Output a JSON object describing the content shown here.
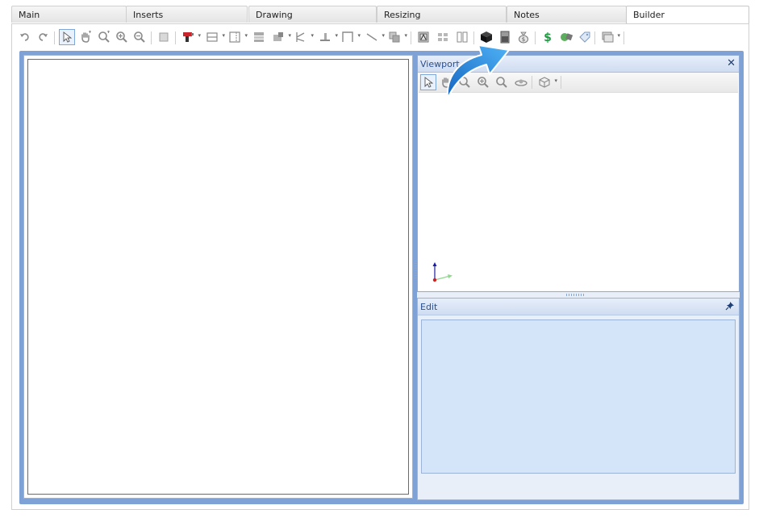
{
  "tabs": [
    {
      "label": "Main",
      "active": false
    },
    {
      "label": "Inserts",
      "active": false
    },
    {
      "label": "Drawing",
      "active": false
    },
    {
      "label": "Resizing",
      "active": false
    },
    {
      "label": "Notes",
      "active": false
    },
    {
      "label": "Builder",
      "active": true
    }
  ],
  "toolbar": {
    "icons": [
      "undo-icon",
      "redo-icon",
      "select-arrow-icon",
      "pan-hand-icon",
      "zoom-extents-icon",
      "zoom-in-icon",
      "zoom-out-icon",
      "page-icon",
      "drill-icon",
      "shelf-icon",
      "panel-icon",
      "drawer-icon",
      "hardware-icon",
      "route-icon",
      "level-icon",
      "frame-icon",
      "line-icon",
      "group-icon",
      "report-icon",
      "grid-icon",
      "split-icon",
      "cube-icon",
      "cabinet-icon",
      "money-bag-icon",
      "price-icon",
      "materials-icon",
      "tag-icon",
      "window-icon"
    ]
  },
  "viewport": {
    "title": "Viewport",
    "close_symbol": "✕",
    "tools": [
      "select-arrow-icon",
      "pan-hand-icon",
      "zoom-extents-icon",
      "zoom-in-icon",
      "zoom-out-icon",
      "orbit-icon",
      "view-cube-icon"
    ]
  },
  "edit": {
    "title": "Edit"
  },
  "colors": {
    "frame_blue": "#7ea2d6",
    "panel_header": "#cfdcf1",
    "edit_body": "#d5e5f9",
    "callout_arrow": "#1e88d8"
  }
}
